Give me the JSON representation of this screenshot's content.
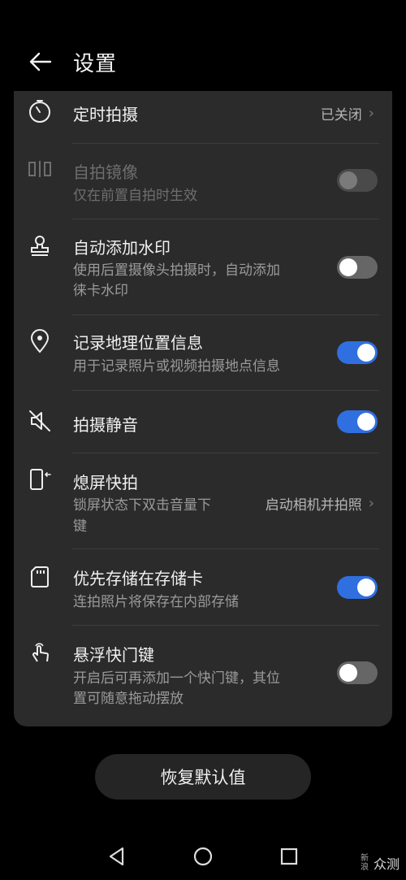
{
  "header": {
    "title": "设置"
  },
  "rows": [
    {
      "label": "定时拍摄",
      "value": "已关闭"
    },
    {
      "label": "自拍镜像",
      "sub": "仅在前置自拍时生效",
      "toggle": "off-disabled"
    },
    {
      "label": "自动添加水印",
      "sub_line1": "使用后置摄像头拍摄时，自动添加",
      "sub_line2": "徕卡水印",
      "toggle": "off"
    },
    {
      "label": "记录地理位置信息",
      "sub": "用于记录照片或视频拍摄地点信息",
      "toggle": "on"
    },
    {
      "label": "拍摄静音",
      "toggle": "on"
    },
    {
      "label": "熄屏快拍",
      "sub_line1": "锁屏状态下双击音量下",
      "sub_line2": "键",
      "value": "启动相机并拍照"
    },
    {
      "label": "优先存储在存储卡",
      "sub": "连拍照片将保存在内部存储",
      "toggle": "on"
    },
    {
      "label": "悬浮快门键",
      "sub_line1": "开启后可再添加一个快门键，其位",
      "sub_line2": "置可随意拖动摆放",
      "toggle": "off"
    }
  ],
  "restore_button": "恢复默认值",
  "watermark": {
    "small": "新浪",
    "big": "众测"
  },
  "colors": {
    "accent": "#2f6fe0",
    "card": "#2b2b2b",
    "background": "#000000"
  }
}
